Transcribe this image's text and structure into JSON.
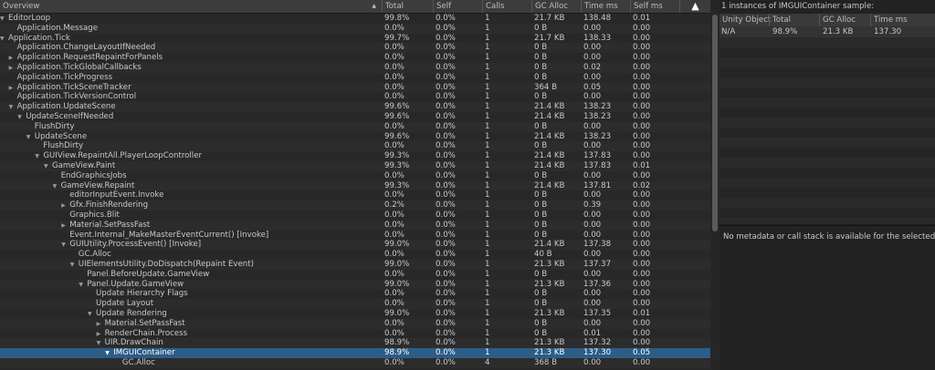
{
  "header": {
    "overview": "Overview",
    "total": "Total",
    "self": "Self",
    "calls": "Calls",
    "gc_alloc": "GC Alloc",
    "time_ms": "Time ms",
    "self_ms": "Self ms"
  },
  "rows": [
    {
      "name": "EditorLoop",
      "depth": 0,
      "arrow": "open",
      "total": "99.8%",
      "self": "0.0%",
      "calls": "1",
      "gc": "21.7 KB",
      "time": "138.48",
      "selfms": "0.01"
    },
    {
      "name": "Application.Message",
      "depth": 1,
      "arrow": "none",
      "total": "0.0%",
      "self": "0.0%",
      "calls": "1",
      "gc": "0 B",
      "time": "0.00",
      "selfms": "0.00"
    },
    {
      "name": "Application.Tick",
      "depth": 0,
      "arrow": "open",
      "total": "99.7%",
      "self": "0.0%",
      "calls": "1",
      "gc": "21.7 KB",
      "time": "138.33",
      "selfms": "0.00"
    },
    {
      "name": "Application.ChangeLayoutIfNeeded",
      "depth": 1,
      "arrow": "none",
      "total": "0.0%",
      "self": "0.0%",
      "calls": "1",
      "gc": "0 B",
      "time": "0.00",
      "selfms": "0.00"
    },
    {
      "name": "Application.RequestRepaintForPanels",
      "depth": 1,
      "arrow": "closed",
      "total": "0.0%",
      "self": "0.0%",
      "calls": "1",
      "gc": "0 B",
      "time": "0.00",
      "selfms": "0.00"
    },
    {
      "name": "Application.TickGlobalCallbacks",
      "depth": 1,
      "arrow": "closed",
      "total": "0.0%",
      "self": "0.0%",
      "calls": "1",
      "gc": "0 B",
      "time": "0.02",
      "selfms": "0.00"
    },
    {
      "name": "Application.TickProgress",
      "depth": 1,
      "arrow": "none",
      "total": "0.0%",
      "self": "0.0%",
      "calls": "1",
      "gc": "0 B",
      "time": "0.00",
      "selfms": "0.00"
    },
    {
      "name": "Application.TickSceneTracker",
      "depth": 1,
      "arrow": "closed",
      "total": "0.0%",
      "self": "0.0%",
      "calls": "1",
      "gc": "364 B",
      "time": "0.05",
      "selfms": "0.00"
    },
    {
      "name": "Application.TickVersionControl",
      "depth": 1,
      "arrow": "none",
      "total": "0.0%",
      "self": "0.0%",
      "calls": "1",
      "gc": "0 B",
      "time": "0.00",
      "selfms": "0.00"
    },
    {
      "name": "Application.UpdateScene",
      "depth": 1,
      "arrow": "open",
      "total": "99.6%",
      "self": "0.0%",
      "calls": "1",
      "gc": "21.4 KB",
      "time": "138.23",
      "selfms": "0.00"
    },
    {
      "name": "UpdateSceneIfNeeded",
      "depth": 2,
      "arrow": "open",
      "total": "99.6%",
      "self": "0.0%",
      "calls": "1",
      "gc": "21.4 KB",
      "time": "138.23",
      "selfms": "0.00"
    },
    {
      "name": "FlushDirty",
      "depth": 3,
      "arrow": "none",
      "total": "0.0%",
      "self": "0.0%",
      "calls": "1",
      "gc": "0 B",
      "time": "0.00",
      "selfms": "0.00"
    },
    {
      "name": "UpdateScene",
      "depth": 3,
      "arrow": "open",
      "total": "99.6%",
      "self": "0.0%",
      "calls": "1",
      "gc": "21.4 KB",
      "time": "138.23",
      "selfms": "0.00"
    },
    {
      "name": "FlushDirty",
      "depth": 4,
      "arrow": "none",
      "total": "0.0%",
      "self": "0.0%",
      "calls": "1",
      "gc": "0 B",
      "time": "0.00",
      "selfms": "0.00"
    },
    {
      "name": "GUIView.RepaintAll.PlayerLoopController",
      "depth": 4,
      "arrow": "open",
      "total": "99.3%",
      "self": "0.0%",
      "calls": "1",
      "gc": "21.4 KB",
      "time": "137.83",
      "selfms": "0.00"
    },
    {
      "name": "GameView.Paint",
      "depth": 5,
      "arrow": "open",
      "total": "99.3%",
      "self": "0.0%",
      "calls": "1",
      "gc": "21.4 KB",
      "time": "137.83",
      "selfms": "0.01"
    },
    {
      "name": "EndGraphicsJobs",
      "depth": 6,
      "arrow": "none",
      "total": "0.0%",
      "self": "0.0%",
      "calls": "1",
      "gc": "0 B",
      "time": "0.00",
      "selfms": "0.00"
    },
    {
      "name": "GameView.Repaint",
      "depth": 6,
      "arrow": "open",
      "total": "99.3%",
      "self": "0.0%",
      "calls": "1",
      "gc": "21.4 KB",
      "time": "137.81",
      "selfms": "0.02"
    },
    {
      "name": "editorInputEvent.Invoke",
      "depth": 7,
      "arrow": "none",
      "total": "0.0%",
      "self": "0.0%",
      "calls": "1",
      "gc": "0 B",
      "time": "0.00",
      "selfms": "0.00"
    },
    {
      "name": "Gfx.FinishRendering",
      "depth": 7,
      "arrow": "closed",
      "total": "0.2%",
      "self": "0.0%",
      "calls": "1",
      "gc": "0 B",
      "time": "0.39",
      "selfms": "0.00"
    },
    {
      "name": "Graphics.Blit",
      "depth": 7,
      "arrow": "none",
      "total": "0.0%",
      "self": "0.0%",
      "calls": "1",
      "gc": "0 B",
      "time": "0.00",
      "selfms": "0.00"
    },
    {
      "name": "Material.SetPassFast",
      "depth": 7,
      "arrow": "closed",
      "total": "0.0%",
      "self": "0.0%",
      "calls": "1",
      "gc": "0 B",
      "time": "0.00",
      "selfms": "0.00"
    },
    {
      "name": "Event.Internal_MakeMasterEventCurrent() [Invoke]",
      "depth": 7,
      "arrow": "none",
      "total": "0.0%",
      "self": "0.0%",
      "calls": "1",
      "gc": "0 B",
      "time": "0.00",
      "selfms": "0.00"
    },
    {
      "name": "GUIUtility.ProcessEvent() [Invoke]",
      "depth": 7,
      "arrow": "open",
      "total": "99.0%",
      "self": "0.0%",
      "calls": "1",
      "gc": "21.4 KB",
      "time": "137.38",
      "selfms": "0.00"
    },
    {
      "name": "GC.Alloc",
      "depth": 8,
      "arrow": "none",
      "total": "0.0%",
      "self": "0.0%",
      "calls": "1",
      "gc": "40 B",
      "time": "0.00",
      "selfms": "0.00"
    },
    {
      "name": "UIElementsUtility.DoDispatch(Repaint Event)",
      "depth": 8,
      "arrow": "open",
      "total": "99.0%",
      "self": "0.0%",
      "calls": "1",
      "gc": "21.3 KB",
      "time": "137.37",
      "selfms": "0.00"
    },
    {
      "name": "Panel.BeforeUpdate.GameView",
      "depth": 9,
      "arrow": "none",
      "total": "0.0%",
      "self": "0.0%",
      "calls": "1",
      "gc": "0 B",
      "time": "0.00",
      "selfms": "0.00"
    },
    {
      "name": "Panel.Update.GameView",
      "depth": 9,
      "arrow": "open",
      "total": "99.0%",
      "self": "0.0%",
      "calls": "1",
      "gc": "21.3 KB",
      "time": "137.36",
      "selfms": "0.00"
    },
    {
      "name": "Update Hierarchy Flags",
      "depth": 10,
      "arrow": "none",
      "total": "0.0%",
      "self": "0.0%",
      "calls": "1",
      "gc": "0 B",
      "time": "0.00",
      "selfms": "0.00"
    },
    {
      "name": "Update Layout",
      "depth": 10,
      "arrow": "none",
      "total": "0.0%",
      "self": "0.0%",
      "calls": "1",
      "gc": "0 B",
      "time": "0.00",
      "selfms": "0.00"
    },
    {
      "name": "Update Rendering",
      "depth": 10,
      "arrow": "open",
      "total": "99.0%",
      "self": "0.0%",
      "calls": "1",
      "gc": "21.3 KB",
      "time": "137.35",
      "selfms": "0.01"
    },
    {
      "name": "Material.SetPassFast",
      "depth": 11,
      "arrow": "closed",
      "total": "0.0%",
      "self": "0.0%",
      "calls": "1",
      "gc": "0 B",
      "time": "0.00",
      "selfms": "0.00"
    },
    {
      "name": "RenderChain.Process",
      "depth": 11,
      "arrow": "closed",
      "total": "0.0%",
      "self": "0.0%",
      "calls": "1",
      "gc": "0 B",
      "time": "0.01",
      "selfms": "0.00"
    },
    {
      "name": "UIR.DrawChain",
      "depth": 11,
      "arrow": "open",
      "total": "98.9%",
      "self": "0.0%",
      "calls": "1",
      "gc": "21.3 KB",
      "time": "137.32",
      "selfms": "0.00"
    },
    {
      "name": "IMGUIContainer",
      "depth": 12,
      "arrow": "open",
      "total": "98.9%",
      "self": "0.0%",
      "calls": "1",
      "gc": "21.3 KB",
      "time": "137.30",
      "selfms": "0.05",
      "selected": true
    },
    {
      "name": "GC.Alloc",
      "depth": 13,
      "arrow": "none",
      "total": "0.0%",
      "self": "0.0%",
      "calls": "4",
      "gc": "368 B",
      "time": "0.00",
      "selfms": "0.00"
    }
  ],
  "right": {
    "title": "1 instances of IMGUIContainer sample:",
    "headers": {
      "object": "Unity Object",
      "total": "Total",
      "gc": "GC Alloc",
      "time": "Time ms"
    },
    "row": {
      "object": "N/A",
      "total": "98.9%",
      "gc": "21.3 KB",
      "time": "137.30"
    },
    "message": "No metadata or call stack is available for the selected sample"
  }
}
